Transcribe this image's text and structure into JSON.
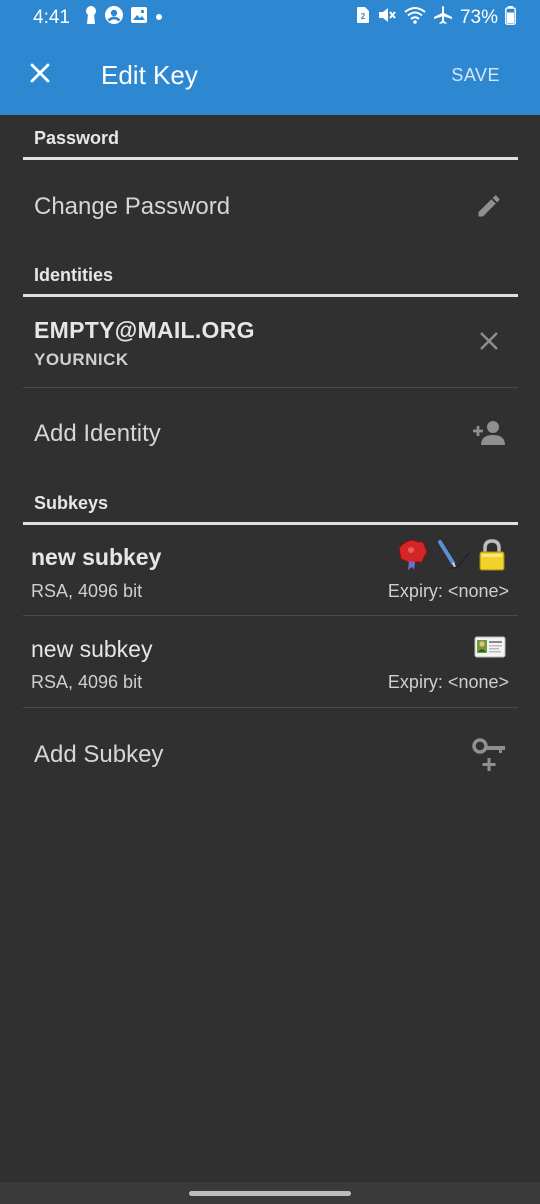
{
  "status_bar": {
    "time": "4:41",
    "battery": "73%",
    "icons_left": [
      "keyhole-icon",
      "account-icon",
      "image-icon",
      "dot-icon"
    ],
    "icons_right": [
      "sim-icon",
      "mute-icon",
      "wifi-icon",
      "airplane-icon",
      "battery-icon"
    ]
  },
  "app_bar": {
    "title": "Edit Key",
    "save_label": "SAVE",
    "close_icon": "close-icon",
    "color": "#2d88d1"
  },
  "password": {
    "header": "Password",
    "change_label": "Change Password",
    "edit_icon": "pencil-icon"
  },
  "identities": {
    "header": "Identities",
    "items": [
      {
        "email": "EMPTY@MAIL.ORG",
        "nick": "YOURNICK",
        "remove_icon": "close-icon"
      }
    ],
    "add_label": "Add Identity",
    "add_icon": "add-person-icon"
  },
  "subkeys": {
    "header": "Subkeys",
    "items": [
      {
        "title": "new subkey",
        "algo": "RSA, 4096 bit",
        "expiry": "Expiry: <none>",
        "flags": [
          "certify-seal-icon",
          "sign-pen-icon",
          "encrypt-lock-icon"
        ]
      },
      {
        "title": "new subkey",
        "algo": "RSA, 4096 bit",
        "expiry": "Expiry: <none>",
        "flags": [
          "authenticate-card-icon"
        ]
      }
    ],
    "add_label": "Add Subkey",
    "add_icon": "add-key-icon"
  },
  "colors": {
    "background": "#303030",
    "accent": "#2d88d1",
    "text_primary": "#e6e6e6",
    "icon_gray": "#9e9e9e"
  }
}
